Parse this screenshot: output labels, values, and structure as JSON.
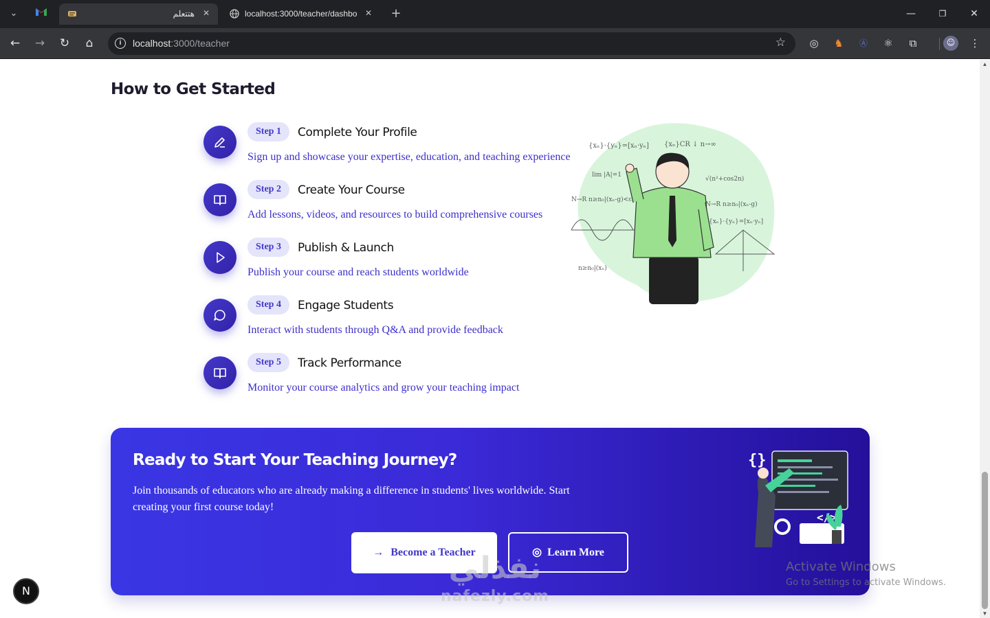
{
  "browser": {
    "tabs": [
      {
        "title": "هتتعلم",
        "active": true
      },
      {
        "title": "localhost:3000/teacher/dashbo",
        "active": false
      }
    ],
    "url_host": "localhost",
    "url_path": ":3000/teacher"
  },
  "page": {
    "section_title": "How to Get Started",
    "steps": [
      {
        "badge": "Step 1",
        "title": "Complete Your Profile",
        "desc": "Sign up and showcase your expertise, education, and teaching experience",
        "icon": "pencil-icon"
      },
      {
        "badge": "Step 2",
        "title": "Create Your Course",
        "desc": "Add lessons, videos, and resources to build comprehensive courses",
        "icon": "book-icon"
      },
      {
        "badge": "Step 3",
        "title": "Publish & Launch",
        "desc": "Publish your course and reach students worldwide",
        "icon": "play-icon"
      },
      {
        "badge": "Step 4",
        "title": "Engage Students",
        "desc": "Interact with students through Q&A and provide feedback",
        "icon": "chat-icon"
      },
      {
        "badge": "Step 5",
        "title": "Track Performance",
        "desc": "Monitor your course analytics and grow your teaching impact",
        "icon": "book-icon"
      }
    ],
    "cta": {
      "title": "Ready to Start Your Teaching Journey?",
      "desc": "Join thousands of educators who are already making a difference in students' lives worldwide. Start creating your first course today!",
      "primary_label": "Become a Teacher",
      "secondary_label": "Learn More"
    }
  },
  "overlays": {
    "dev_badge": "N",
    "activate_title": "Activate Windows",
    "activate_sub": "Go to Settings to activate Windows.",
    "watermark_ar": "نفذلي",
    "watermark_en": "nafezly.com"
  },
  "colors": {
    "accent": "#4338ca",
    "step_pill_bg": "#e4e4fb",
    "cta_start": "#3a36e4",
    "cta_end": "#24109a"
  }
}
